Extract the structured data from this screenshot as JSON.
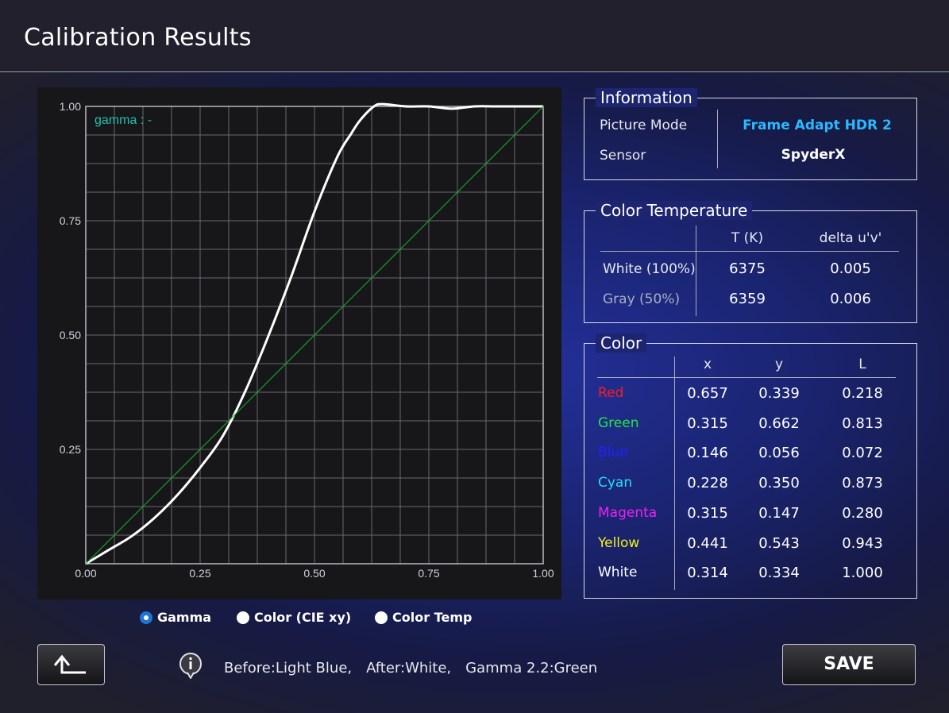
{
  "header": {
    "title": "Calibration Results"
  },
  "graph": {
    "gamma_label": "gamma : -",
    "y_ticks": [
      "1.00",
      "0.75",
      "0.50",
      "0.25"
    ],
    "x_ticks": [
      "0.00",
      "0.25",
      "0.50",
      "0.75",
      "1.00"
    ]
  },
  "information": {
    "legend": "Information",
    "picture_mode_label": "Picture Mode",
    "picture_mode_value": "Frame Adapt HDR 2",
    "sensor_label": "Sensor",
    "sensor_value": "SpyderX"
  },
  "color_temperature": {
    "legend": "Color Temperature",
    "col_t": "T (K)",
    "col_delta": "delta u'v'",
    "rows": [
      {
        "label": "White (100%)",
        "t": "6375",
        "delta": "0.005"
      },
      {
        "label": "Gray (50%)",
        "t": "6359",
        "delta": "0.006"
      }
    ]
  },
  "color": {
    "legend": "Color",
    "col_x": "x",
    "col_y": "y",
    "col_l": "L",
    "rows": [
      {
        "label": "Red",
        "x": "0.657",
        "y": "0.339",
        "l": "0.218"
      },
      {
        "label": "Green",
        "x": "0.315",
        "y": "0.662",
        "l": "0.813"
      },
      {
        "label": "Blue",
        "x": "0.146",
        "y": "0.056",
        "l": "0.072"
      },
      {
        "label": "Cyan",
        "x": "0.228",
        "y": "0.350",
        "l": "0.873"
      },
      {
        "label": "Magenta",
        "x": "0.315",
        "y": "0.147",
        "l": "0.280"
      },
      {
        "label": "Yellow",
        "x": "0.441",
        "y": "0.543",
        "l": "0.943"
      },
      {
        "label": "White",
        "x": "0.314",
        "y": "0.334",
        "l": "1.000"
      }
    ]
  },
  "radios": {
    "gamma": "Gamma",
    "color_cie": "Color (CIE xy)",
    "color_temp": "Color Temp",
    "selected": "Gamma"
  },
  "footer": {
    "note": "Before:Light Blue,　After:White,　Gamma 2.2:Green",
    "save_label": "SAVE"
  },
  "colors": {
    "accent": "#2ab8ff",
    "red": "#ff1a1a",
    "green": "#22e840",
    "blue": "#2020ff",
    "cyan": "#22e0f0",
    "magenta": "#f020f0",
    "yellow": "#f0f020",
    "white": "#ffffff",
    "gamma_label": "#20c0b0",
    "gray_label": "#aab0c0"
  },
  "chart_data": {
    "type": "line",
    "xlim": [
      0,
      1
    ],
    "ylim": [
      0,
      1
    ],
    "grid": true,
    "series": [
      {
        "color": "#ffffff",
        "x": [
          0,
          0.05,
          0.1,
          0.15,
          0.2,
          0.25,
          0.3,
          0.35,
          0.4,
          0.45,
          0.5,
          0.55,
          0.58,
          0.6,
          0.63,
          0.65,
          0.7,
          0.75,
          0.8,
          0.85,
          0.9,
          1.0
        ],
        "y": [
          0,
          0.03,
          0.06,
          0.1,
          0.15,
          0.21,
          0.28,
          0.38,
          0.5,
          0.63,
          0.77,
          0.89,
          0.94,
          0.97,
          1.0,
          1.005,
          1.0,
          1.0,
          0.995,
          1.0,
          1.0,
          1.0
        ]
      },
      {
        "color": "#1a9a2a",
        "x": [
          0,
          1
        ],
        "y": [
          0,
          1
        ]
      }
    ]
  }
}
